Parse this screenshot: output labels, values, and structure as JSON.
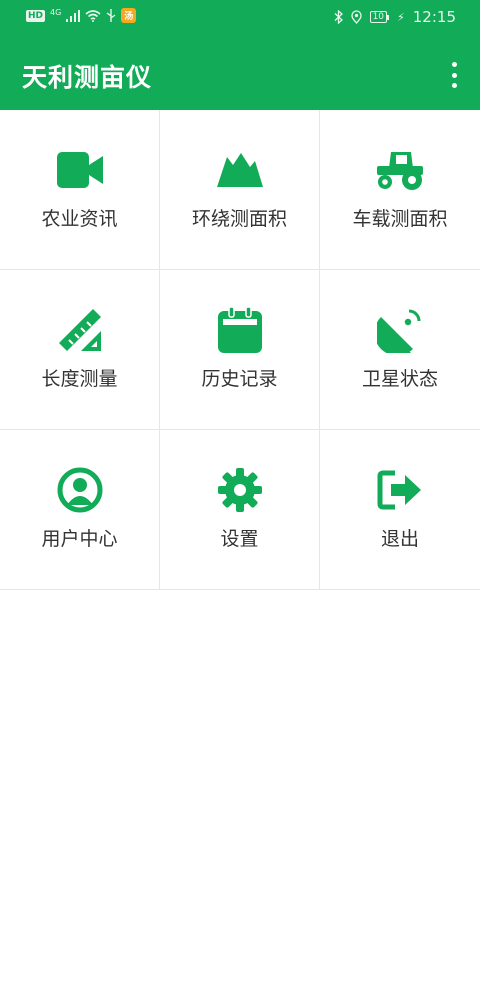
{
  "status_bar": {
    "left_badge": "HD",
    "network": "4G",
    "notification": "汤",
    "battery": "10",
    "time": "12:15"
  },
  "app_bar": {
    "title": "天利测亩仪",
    "menu_icon": "more-vertical-icon"
  },
  "colors": {
    "primary": "#12ab58",
    "text": "#333333",
    "divider": "#e6e6e6"
  },
  "menu_items": [
    {
      "label": "农业资讯",
      "icon": "video-camera-icon"
    },
    {
      "label": "环绕测面积",
      "icon": "mountain-icon"
    },
    {
      "label": "车载测面积",
      "icon": "tractor-icon"
    },
    {
      "label": "长度测量",
      "icon": "ruler-triangle-icon"
    },
    {
      "label": "历史记录",
      "icon": "calendar-icon"
    },
    {
      "label": "卫星状态",
      "icon": "satellite-dish-icon"
    },
    {
      "label": "用户中心",
      "icon": "user-circle-icon"
    },
    {
      "label": "设置",
      "icon": "gear-icon"
    },
    {
      "label": "退出",
      "icon": "sign-out-icon"
    }
  ]
}
